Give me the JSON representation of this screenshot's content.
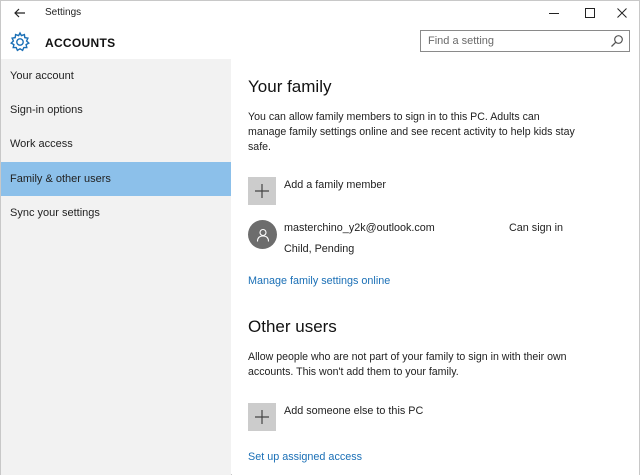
{
  "window": {
    "title": "Settings"
  },
  "header": {
    "title": "ACCOUNTS",
    "search_placeholder": "Find a setting"
  },
  "sidebar": {
    "items": [
      {
        "label": "Your account",
        "active": false
      },
      {
        "label": "Sign-in options",
        "active": false
      },
      {
        "label": "Work access",
        "active": false
      },
      {
        "label": "Family & other users",
        "active": true
      },
      {
        "label": "Sync your settings",
        "active": false
      }
    ]
  },
  "family": {
    "heading": "Your family",
    "description": "You can allow family members to sign in to this PC. Adults can manage family settings online and see recent activity to help kids stay safe.",
    "add_label": "Add a family member",
    "member": {
      "email": "masterchino_y2k@outlook.com",
      "status": "Child, Pending",
      "access": "Can sign in"
    },
    "manage_link": "Manage family settings online"
  },
  "other_users": {
    "heading": "Other users",
    "description": "Allow people who are not part of your family to sign in with their own accounts. This won't add them to your family.",
    "add_label": "Add someone else to this PC",
    "assigned_access_link": "Set up assigned access"
  },
  "colors": {
    "accent": "#1a6fb6",
    "selected_nav": "#8cc0ea",
    "sidebar_bg": "#f2f2f2",
    "tile_bg": "#cccccc",
    "avatar_bg": "#6d6d6d"
  }
}
